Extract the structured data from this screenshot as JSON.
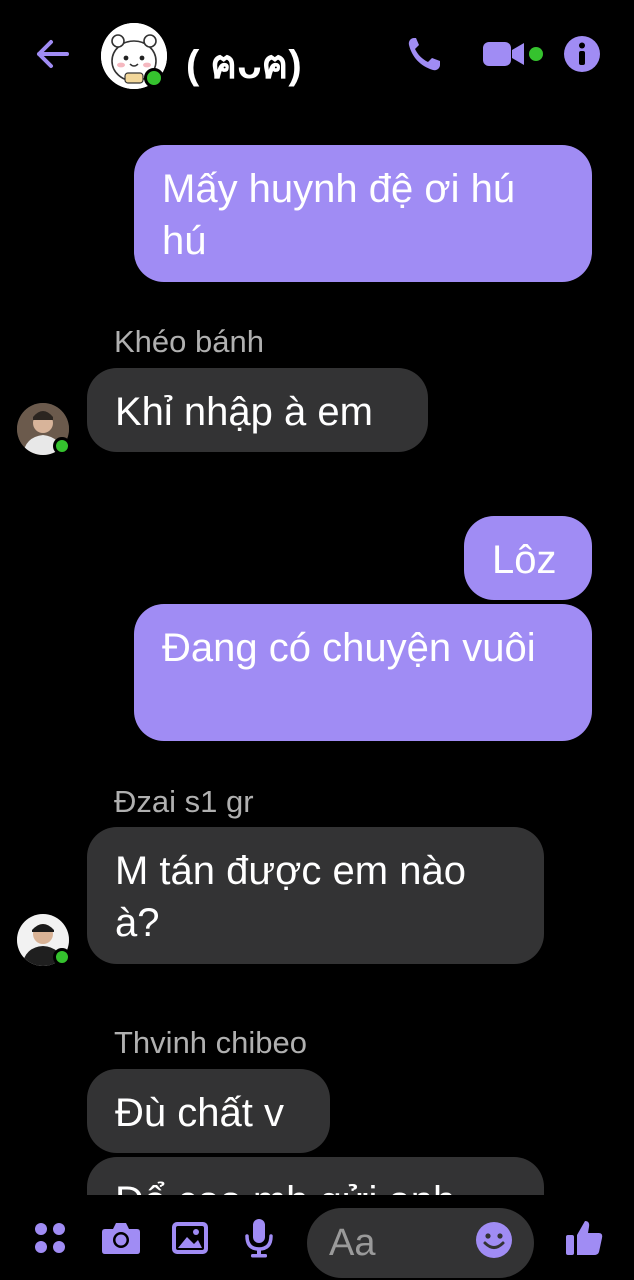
{
  "header": {
    "title": "( ฅᴗฅ)",
    "back_icon": "arrow-left-icon",
    "call_icon": "phone-icon",
    "video_icon": "video-camera-icon",
    "info_icon": "info-icon",
    "accent": "#a08cf4",
    "online": "#35c22e"
  },
  "messages": [
    {
      "kind": "outgoing",
      "text": "Mấy huynh đệ ơi hú hú"
    },
    {
      "kind": "incoming",
      "sender": "Khéo bánh",
      "text": "Khỉ nhập à em"
    },
    {
      "kind": "outgoing",
      "text": "Lôz"
    },
    {
      "kind": "outgoing",
      "text": "Đang có chuyện vuôi"
    },
    {
      "kind": "incoming",
      "sender": "Đzai s1 gr",
      "text": "M tán được em nào à?"
    },
    {
      "kind": "incoming",
      "sender": "Thvinh chibeo",
      "text": "Đù chất v"
    },
    {
      "kind": "incoming",
      "text": "Để coo mh gửi anh"
    }
  ],
  "composer": {
    "placeholder": "Aa",
    "apps_icon": "four-dots-icon",
    "camera_icon": "camera-icon",
    "gallery_icon": "image-icon",
    "mic_icon": "microphone-icon",
    "emoji_icon": "smiley-icon",
    "like_icon": "thumbs-up-icon"
  }
}
